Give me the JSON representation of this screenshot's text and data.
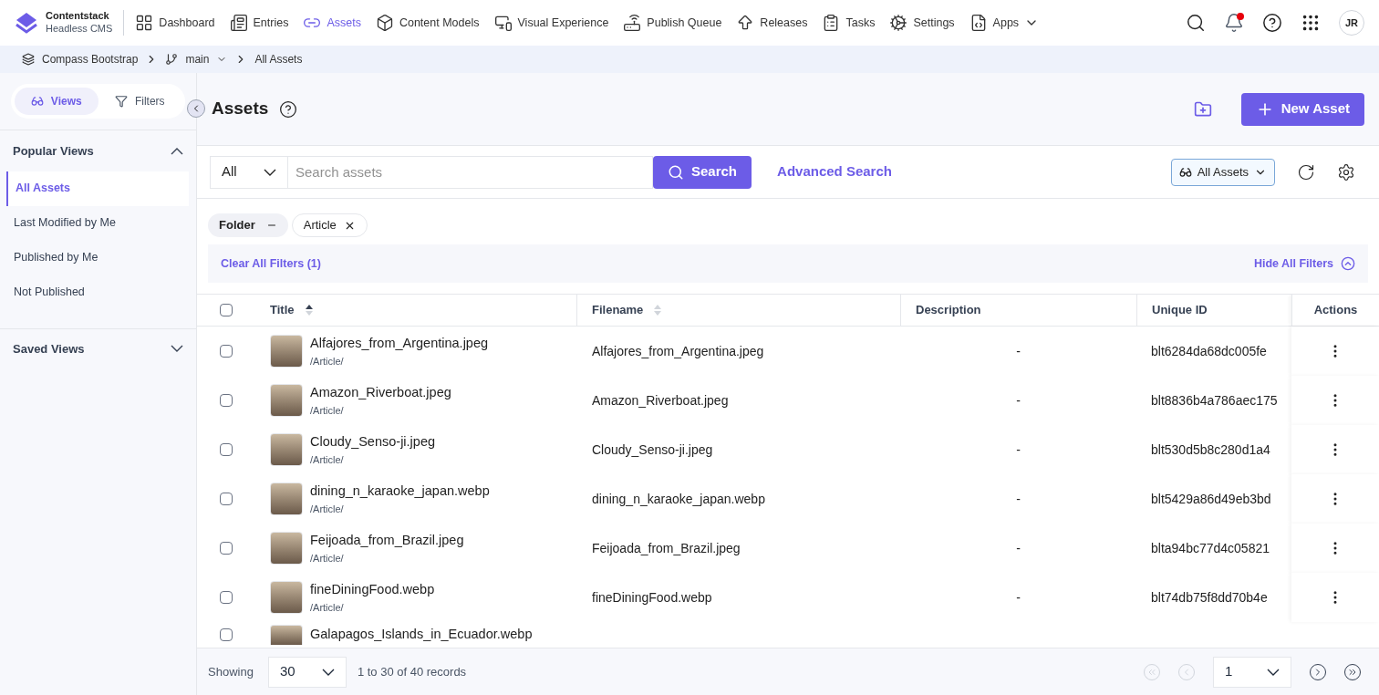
{
  "brand": {
    "name": "Contentstack",
    "subtitle": "Headless CMS"
  },
  "nav": [
    {
      "label": "Dashboard",
      "selected": false
    },
    {
      "label": "Entries",
      "selected": false
    },
    {
      "label": "Assets",
      "selected": true
    },
    {
      "label": "Content Models",
      "selected": false
    },
    {
      "label": "Visual Experience",
      "selected": false
    },
    {
      "label": "Publish Queue",
      "selected": false
    },
    {
      "label": "Releases",
      "selected": false
    },
    {
      "label": "Tasks",
      "selected": false
    },
    {
      "label": "Settings",
      "selected": false
    },
    {
      "label": "Apps",
      "selected": false,
      "dropdown": true
    }
  ],
  "notifications": {
    "unread": true
  },
  "avatar": {
    "initials": "JR"
  },
  "breadcrumb": {
    "stack": "Compass Bootstrap",
    "branch": "main",
    "page": "All Assets"
  },
  "sidebar": {
    "tabs": [
      {
        "label": "Views",
        "selected": true
      },
      {
        "label": "Filters",
        "selected": false
      }
    ],
    "popular": {
      "title": "Popular Views",
      "expanded": true,
      "items": [
        {
          "label": "All Assets",
          "selected": true
        },
        {
          "label": "Last Modified by Me",
          "selected": false
        },
        {
          "label": "Published by Me",
          "selected": false
        },
        {
          "label": "Not Published",
          "selected": false
        }
      ]
    },
    "saved": {
      "title": "Saved Views",
      "expanded": false
    }
  },
  "page": {
    "title": "Assets",
    "primary_button": "New Asset"
  },
  "search": {
    "scope": "All",
    "placeholder": "Search assets",
    "button": "Search",
    "advanced": "Advanced Search",
    "view": "All Assets"
  },
  "filters": {
    "chips": [
      {
        "label": "Folder",
        "kind": "field"
      },
      {
        "label": "Article",
        "kind": "value"
      }
    ],
    "clear": "Clear All Filters (1)",
    "hide": "Hide All Filters"
  },
  "table": {
    "all_checked": false,
    "columns": [
      {
        "label": "Title",
        "sorted": true
      },
      {
        "label": "Filename",
        "sorted": false
      },
      {
        "label": "Description"
      },
      {
        "label": "Unique ID"
      },
      {
        "label": "Actions"
      }
    ],
    "rows": [
      {
        "title": "Alfajores_from_Argentina.jpeg",
        "folder": "/Article/",
        "filename": "Alfajores_from_Argentina.jpeg",
        "description": "-",
        "uid": "blt6284da68dc005fe",
        "checked": false
      },
      {
        "title": "Amazon_Riverboat.jpeg",
        "folder": "/Article/",
        "filename": "Amazon_Riverboat.jpeg",
        "description": "-",
        "uid": "blt8836b4a786aec175",
        "checked": false
      },
      {
        "title": "Cloudy_Senso-ji.jpeg",
        "folder": "/Article/",
        "filename": "Cloudy_Senso-ji.jpeg",
        "description": "-",
        "uid": "blt530d5b8c280d1a4",
        "checked": false
      },
      {
        "title": "dining_n_karaoke_japan.webp",
        "folder": "/Article/",
        "filename": "dining_n_karaoke_japan.webp",
        "description": "-",
        "uid": "blt5429a86d49eb3bd",
        "checked": false
      },
      {
        "title": "Feijoada_from_Brazil.jpeg",
        "folder": "/Article/",
        "filename": "Feijoada_from_Brazil.jpeg",
        "description": "-",
        "uid": "blta94bc77d4c05821",
        "checked": false
      },
      {
        "title": "fineDiningFood.webp",
        "folder": "/Article/",
        "filename": "fineDiningFood.webp",
        "description": "-",
        "uid": "blt74db75f8dd70b4e",
        "checked": false
      },
      {
        "title": "Galapagos_Islands_in_Ecuador.webp",
        "checked": false
      }
    ]
  },
  "footer": {
    "label": "Showing",
    "page_size": "30",
    "records": "1 to 30 of 40 records",
    "page": "1"
  }
}
